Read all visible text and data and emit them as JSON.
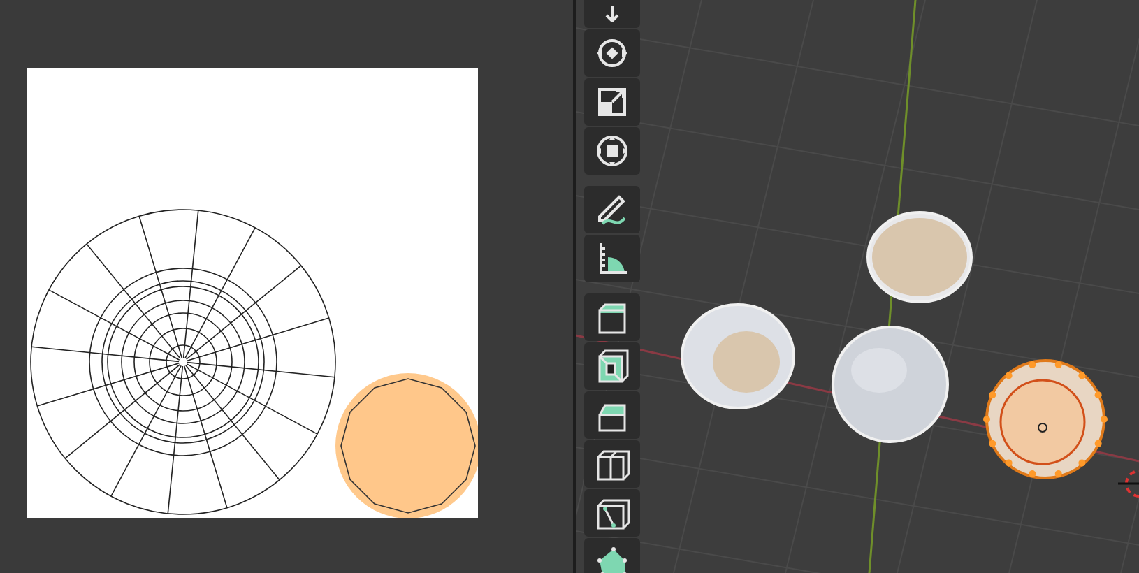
{
  "toolbar": {
    "tools": [
      {
        "kind": "move",
        "selected": false
      },
      {
        "kind": "rotate",
        "selected": false
      },
      {
        "kind": "scale",
        "selected": false
      },
      {
        "kind": "transform",
        "selected": false
      },
      {
        "kind": "annotate",
        "selected": false
      },
      {
        "kind": "measure",
        "selected": false
      },
      {
        "kind": "extrude",
        "selected": false
      },
      {
        "kind": "inset",
        "selected": false
      },
      {
        "kind": "bevel",
        "selected": false
      },
      {
        "kind": "loop-cut",
        "selected": false
      },
      {
        "kind": "knife",
        "selected": false
      },
      {
        "kind": "poly-build",
        "selected": false
      }
    ]
  },
  "viewport": {
    "objects": [
      {
        "kind": "open-bowl",
        "selected": false
      },
      {
        "kind": "rim-cap",
        "selected": false
      },
      {
        "kind": "sphere",
        "selected": false
      },
      {
        "kind": "open-bowl-top",
        "selected": true
      }
    ]
  }
}
